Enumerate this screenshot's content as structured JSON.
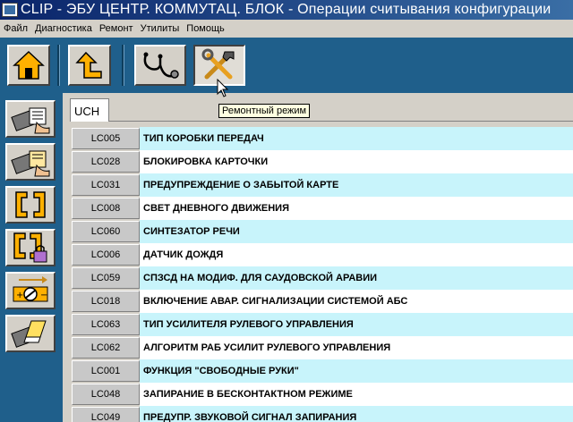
{
  "window": {
    "title": "CLIP - ЭБУ ЦЕНТР. КОММУТАЦ. БЛОК - Операции считывания конфигурации"
  },
  "menu": [
    "Файл",
    "Диагностика",
    "Ремонт",
    "Утилиты",
    "Помощь"
  ],
  "toolbar": {
    "buttons": [
      {
        "name": "home-button",
        "icon": "home-icon"
      },
      {
        "name": "back-button",
        "icon": "back-arrow-icon"
      },
      {
        "name": "diagnostic-button",
        "icon": "stethoscope-icon"
      },
      {
        "name": "repair-mode-button",
        "icon": "tools-icon",
        "pressed": true
      }
    ],
    "tooltip": "Ремонтный режим"
  },
  "sidebar": {
    "buttons": [
      {
        "name": "read-config-button",
        "icon": "chip-hand-read-icon"
      },
      {
        "name": "write-config-button",
        "icon": "chip-hand-write-icon"
      },
      {
        "name": "connector-button",
        "icon": "connector-icon"
      },
      {
        "name": "connector-lock-button",
        "icon": "connector-lock-icon"
      },
      {
        "name": "adjust-button",
        "icon": "gauge-adjust-icon"
      },
      {
        "name": "erase-button",
        "icon": "chip-eraser-icon"
      }
    ]
  },
  "main": {
    "tab": "UCH",
    "rows": [
      {
        "code": "LC005",
        "label": "ТИП КОРОБКИ ПЕРЕДАЧ"
      },
      {
        "code": "LC028",
        "label": "БЛОКИРОВКА КАРТОЧКИ"
      },
      {
        "code": "LC031",
        "label": "ПРЕДУПРЕЖДЕНИЕ О ЗАБЫТОЙ КАРТЕ"
      },
      {
        "code": "LC008",
        "label": "СВЕТ ДНЕВНОГО ДВИЖЕНИЯ"
      },
      {
        "code": "LC060",
        "label": "СИНТЕЗАТОР РЕЧИ"
      },
      {
        "code": "LC006",
        "label": "ДАТЧИК ДОЖДЯ"
      },
      {
        "code": "LC059",
        "label": "СПЗСД НА МОДИФ. ДЛЯ САУДОВСКОЙ АРАВИИ"
      },
      {
        "code": "LC018",
        "label": "ВКЛЮЧЕНИЕ АВАР. СИГНАЛИЗАЦИИ СИСТЕМОЙ АБС"
      },
      {
        "code": "LC063",
        "label": "ТИП УСИЛИТЕЛЯ РУЛЕВОГО УПРАВЛЕНИЯ"
      },
      {
        "code": "LC062",
        "label": "АЛГОРИТМ РАБ УСИЛИТ РУЛЕВОГО УПРАВЛЕНИЯ"
      },
      {
        "code": "LC001",
        "label": "ФУНКЦИЯ \"СВОБОДНЫЕ РУКИ\""
      },
      {
        "code": "LC048",
        "label": "ЗАПИРАНИЕ В БЕСКОНТАКТНОМ РЕЖИМЕ"
      },
      {
        "code": "LC049",
        "label": "ПРЕДУПР. ЗВУКОВОЙ СИГНАЛ ЗАПИРАНИЯ"
      }
    ]
  },
  "colors": {
    "background": "#1f5f8b",
    "row_cyan": "#c8f4fb",
    "row_white": "#ffffff",
    "panel": "#d4d0c8"
  }
}
